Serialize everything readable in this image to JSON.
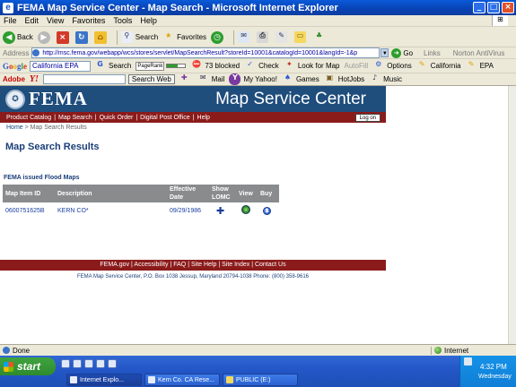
{
  "window": {
    "title": "FEMA Map Service Center - Map Search - Microsoft Internet Explorer",
    "min": "_",
    "max": "□",
    "close": "×"
  },
  "menu": [
    "File",
    "Edit",
    "View",
    "Favorites",
    "Tools",
    "Help"
  ],
  "toolbar": {
    "back": "Back",
    "search": "Search",
    "favorites": "Favorites"
  },
  "address": {
    "label": "Address",
    "url": "http://msc.fema.gov/webapp/wcs/stores/servlet/MapSearchResult?storeId=10001&catalogId=10001&langId=-1&p",
    "go": "Go",
    "links": "Links",
    "norton": "Norton AntiVirus"
  },
  "googlebar": {
    "logo": "Google",
    "search_value": "California EPA",
    "search": "Search",
    "pagerank": "PageRank",
    "blocked": "73 blocked",
    "check": "Check",
    "lookfor": "Look for Map",
    "autofill": "AutoFill",
    "options": "Options",
    "bm1": "California",
    "bm2": "EPA"
  },
  "yahoobar": {
    "adobe": "Adobe",
    "yahoo": "Y!",
    "searchweb": "Search Web",
    "mail": "Mail",
    "myyahoo": "My Yahoo!",
    "games": "Games",
    "hotjobs": "HotJobs",
    "music": "Music"
  },
  "fema": {
    "logo_text": "FEMA",
    "site_title": "Map Service Center",
    "nav": [
      "Product Catalog",
      "Map Search",
      "Quick Order",
      "Digital Post Office",
      "Help"
    ],
    "logon": "Log on",
    "breadcrumb_home": "Home",
    "breadcrumb_sep": " > ",
    "breadcrumb_current": "Map Search Results",
    "page_title": "Map Search Results",
    "section_title": "FEMA issued Flood Maps",
    "table": {
      "headers": [
        "Map Item ID",
        "Description",
        "Effective Date",
        "Show LOMC",
        "View",
        "Buy"
      ],
      "rows": [
        {
          "id": "0600751625B",
          "desc": "KERN CO*",
          "date": "09/29/1986"
        }
      ]
    },
    "footer_links": [
      "FEMA.gov",
      "Accessibility",
      "FAQ",
      "Site Help",
      "Site Index",
      "Contact Us"
    ],
    "footer_address": "FEMA Map Service Center, P.O. Box 1038 Jessup, Maryland 20794-1038 Phone: (800) 358-9616"
  },
  "status": {
    "text": "Done",
    "zone": "Internet"
  },
  "taskbar": {
    "start": "start",
    "tasks": [
      "Internet Explo...",
      "Kern Co. CA Rese...",
      "PUBLIC (E:)"
    ],
    "time": "4:32 PM",
    "day": "Wednesday"
  }
}
